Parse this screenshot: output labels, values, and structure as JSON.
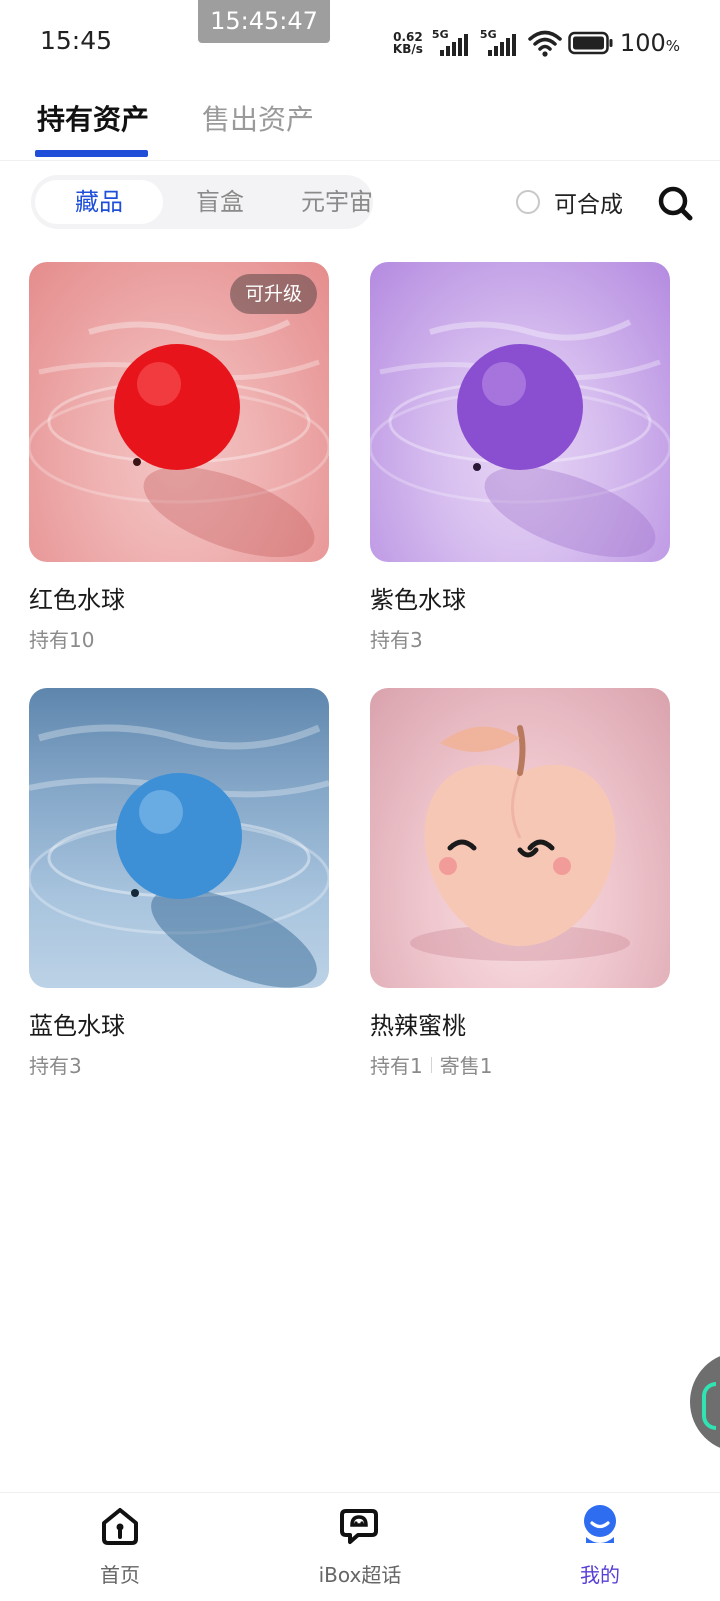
{
  "status_bar": {
    "time": "15:45",
    "overlay_time": "15:45:47",
    "net_speed_value": "0.62",
    "net_speed_unit": "KB/s",
    "sim1": "5G",
    "sim2": "5G",
    "battery_value": "100",
    "battery_unit": "%"
  },
  "top_tabs": [
    {
      "label": "持有资产",
      "active": true
    },
    {
      "label": "售出资产",
      "active": false
    }
  ],
  "filter": {
    "segments": [
      {
        "label": "藏品",
        "active": true
      },
      {
        "label": "盲盒",
        "active": false
      },
      {
        "label": "元宇宙",
        "active": false
      }
    ],
    "composable_label": "可合成",
    "composable_checked": false
  },
  "items": [
    {
      "name": "红色水球",
      "holding": "持有10",
      "badge": "可升级",
      "ball_color": "#e8141c"
    },
    {
      "name": "紫色水球",
      "holding": "持有3",
      "ball_color": "#8a4fd0"
    },
    {
      "name": "蓝色水球",
      "holding": "持有3",
      "ball_color": "#3d8fd6"
    },
    {
      "name": "热辣蜜桃",
      "holding": "持有1",
      "consign": "寄售1",
      "ball_color": "#f7c7b6"
    }
  ],
  "bottom_nav": [
    {
      "label": "首页",
      "icon": "home-icon",
      "active": false
    },
    {
      "label": "iBox超话",
      "icon": "chat-bubble-icon",
      "active": false
    },
    {
      "label": "我的",
      "icon": "profile-icon",
      "active": true
    }
  ],
  "colors": {
    "accent": "#1f4fd8",
    "nav_active": "#5a3fd6"
  }
}
